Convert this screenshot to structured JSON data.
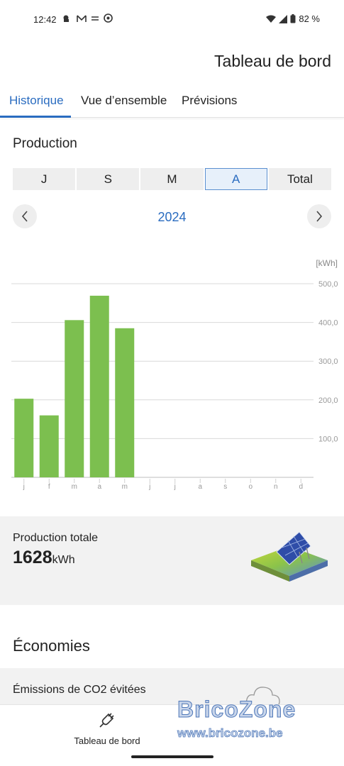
{
  "status_bar": {
    "time": "12:42",
    "battery": "82 %"
  },
  "header": {
    "title": "Tableau de bord"
  },
  "tabs": [
    {
      "label": "Historique",
      "active": true
    },
    {
      "label": "Vue d’ensemble",
      "active": false
    },
    {
      "label": "Prévisions",
      "active": false
    }
  ],
  "production": {
    "title": "Production",
    "periods": [
      {
        "label": "J",
        "active": false
      },
      {
        "label": "S",
        "active": false
      },
      {
        "label": "M",
        "active": false
      },
      {
        "label": "A",
        "active": true
      },
      {
        "label": "Total",
        "active": false
      }
    ],
    "year": "2024"
  },
  "chart_data": {
    "type": "bar",
    "unit": "[kWh]",
    "categories": [
      "j",
      "f",
      "m",
      "a",
      "m",
      "j",
      "j",
      "a",
      "s",
      "o",
      "n",
      "d"
    ],
    "values": [
      203,
      160,
      406,
      469,
      385,
      null,
      null,
      null,
      null,
      null,
      null,
      null
    ],
    "y_ticks": [
      "500,0",
      "400,0",
      "300,0",
      "200,0",
      "100,0"
    ],
    "ylim": [
      0,
      500
    ],
    "bar_color": "#7cbf4f",
    "grid": true
  },
  "summary": {
    "label": "Production totale",
    "value": "1628",
    "unit": "kWh"
  },
  "economies": {
    "title": "Économies",
    "co2_label": "Émissions de CO2 évitées"
  },
  "bottom_nav": {
    "dashboard_label": "Tableau de bord"
  },
  "watermark": {
    "title": "BricoZone",
    "url": "www.bricozone.be"
  },
  "colors": {
    "accent": "#2a6cc0",
    "bar": "#7cbf4f"
  }
}
